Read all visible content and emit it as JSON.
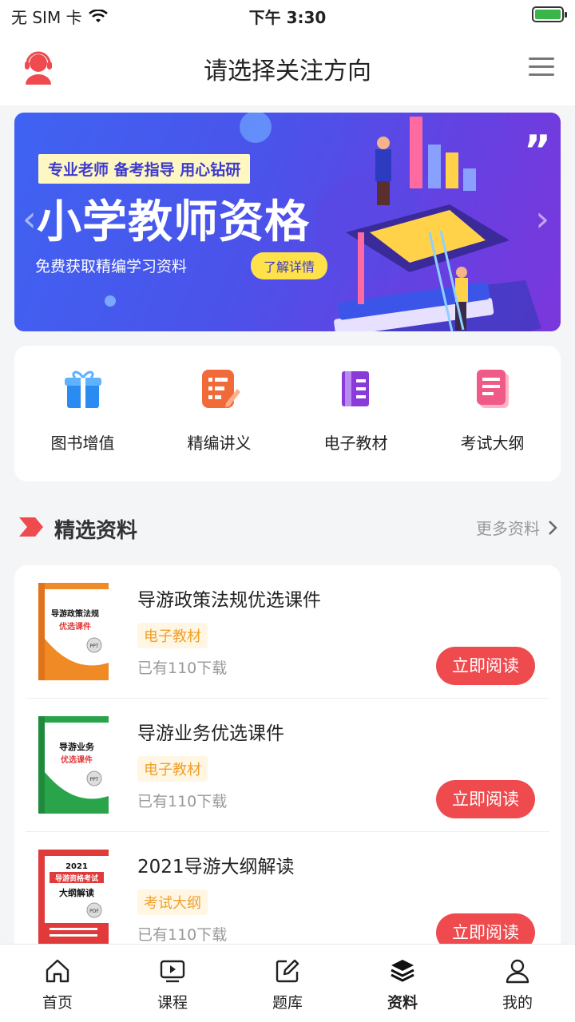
{
  "status_bar": {
    "carrier": "无 SIM 卡",
    "time": "下午 3:30",
    "battery_level": 1.0
  },
  "header": {
    "title": "请选择关注方向"
  },
  "banner": {
    "tagline": "专业老师  备考指导  用心钻研",
    "title": "小学教师资格",
    "subtitle": "免费获取精编学习资料",
    "button": "了解详情"
  },
  "quick_entries": [
    {
      "label": "图书增值",
      "icon": "gift-icon",
      "color": "#2a8cf0"
    },
    {
      "label": "精编讲义",
      "icon": "notes-icon",
      "color": "#f06a3a"
    },
    {
      "label": "电子教材",
      "icon": "ebook-icon",
      "color": "#8a3ad8"
    },
    {
      "label": "考试大纲",
      "icon": "outline-icon",
      "color": "#f05a86"
    }
  ],
  "section": {
    "title": "精选资料",
    "more": "更多资料"
  },
  "resources": [
    {
      "title": "导游政策法规优选课件",
      "tag": "电子教材",
      "downloads": "已有110下载",
      "action": "立即阅读",
      "cover": {
        "line1": "导游政策法规",
        "line2": "优选课件",
        "badge": "PPT",
        "color": "#f08a24"
      }
    },
    {
      "title": "导游业务优选课件",
      "tag": "电子教材",
      "downloads": "已有110下载",
      "action": "立即阅读",
      "cover": {
        "line1": "导游业务",
        "line2": "优选课件",
        "badge": "PPT",
        "color": "#2aa44a"
      }
    },
    {
      "title": "2021导游大纲解读",
      "tag": "考试大纲",
      "downloads": "已有110下载",
      "action": "立即阅读",
      "cover": {
        "year": "2021",
        "line1": "导游资格考试",
        "line2": "大纲解读",
        "badge": "PDF",
        "color": "#e03a3a"
      }
    }
  ],
  "tabs": [
    {
      "label": "首页",
      "icon": "home-icon",
      "active": false
    },
    {
      "label": "课程",
      "icon": "video-icon",
      "active": false
    },
    {
      "label": "题库",
      "icon": "edit-icon",
      "active": false
    },
    {
      "label": "资料",
      "icon": "layers-icon",
      "active": true
    },
    {
      "label": "我的",
      "icon": "user-icon",
      "active": false
    }
  ]
}
